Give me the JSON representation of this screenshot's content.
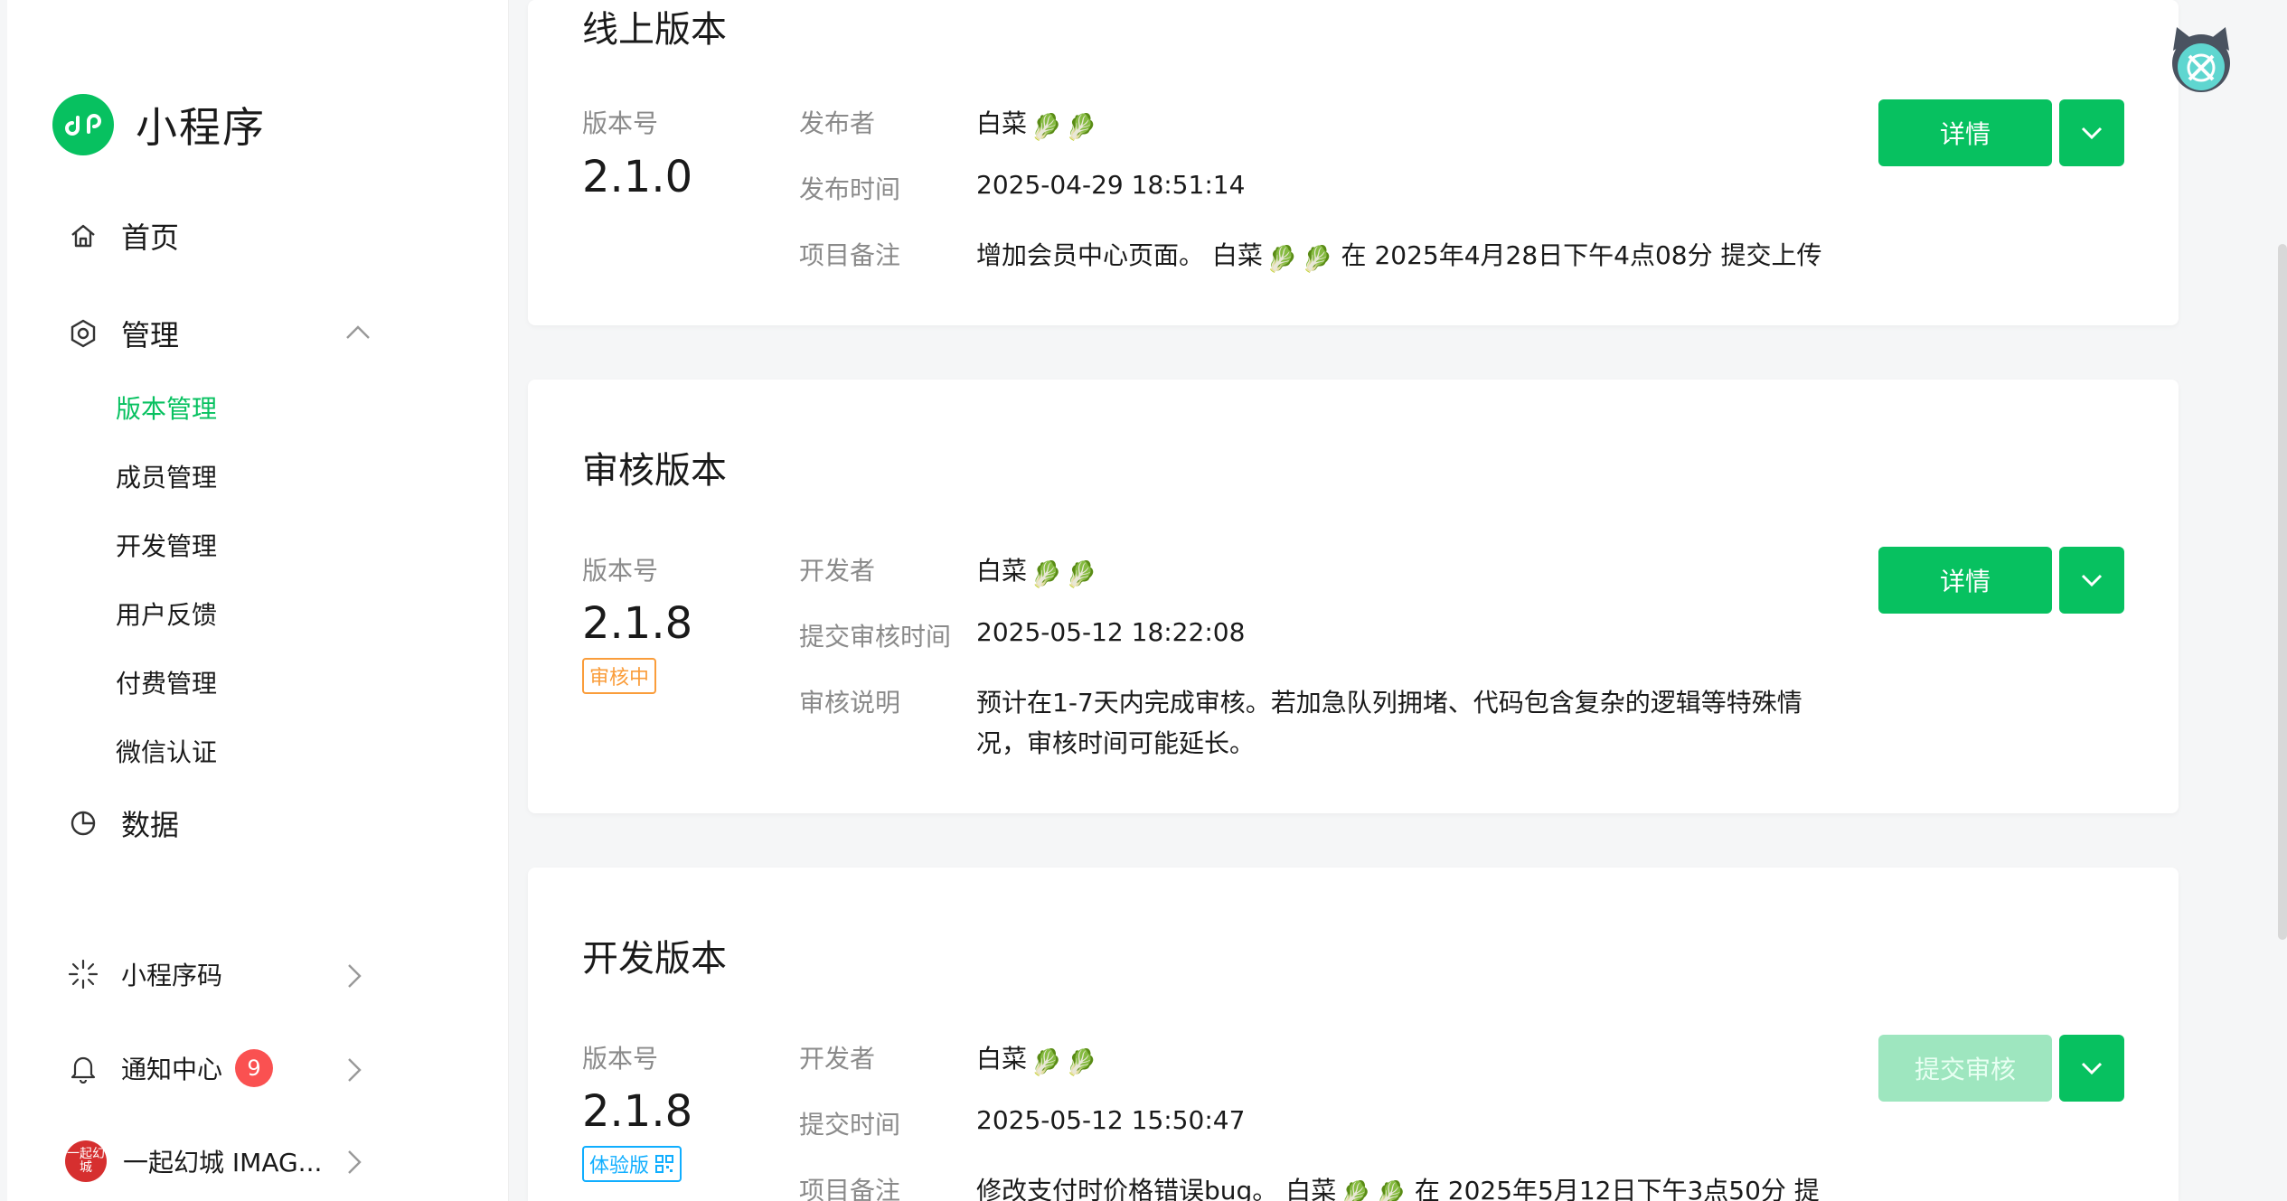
{
  "sidebar": {
    "brand": "小程序",
    "nav": {
      "home": "首页",
      "manage": "管理",
      "data": "数据",
      "qrcode": "小程序码",
      "notify": "通知中心",
      "notify_badge": "9",
      "account": "一起幻城 IMAG...",
      "account_avatar": "一起幻城"
    },
    "sub_items": [
      "版本管理",
      "成员管理",
      "开发管理",
      "用户反馈",
      "付费管理",
      "微信认证"
    ]
  },
  "cards": {
    "online": {
      "title": "线上版本",
      "version_label": "版本号",
      "version": "2.1.0",
      "labels": [
        "发布者",
        "发布时间",
        "项目备注"
      ],
      "publisher": "白菜",
      "time": "2025-04-29 18:51:14",
      "note_pre": "增加会员中心页面。 白菜",
      "note_post": " 在 2025年4月28日下午4点08分 提交上传",
      "btn": "详情"
    },
    "review": {
      "title": "审核版本",
      "version_label": "版本号",
      "version": "2.1.8",
      "tag": "审核中",
      "labels": [
        "开发者",
        "提交审核时间",
        "审核说明"
      ],
      "developer": "白菜",
      "time": "2025-05-12 18:22:08",
      "desc1": "预计在1-7天内完成审核。若加急队列拥堵、代码包含复杂的逻辑等特殊情",
      "desc2": "况，审核时间可能延长。",
      "btn": "详情"
    },
    "dev": {
      "title": "开发版本",
      "version_label": "版本号",
      "version": "2.1.8",
      "tag": "体验版",
      "labels": [
        "开发者",
        "提交时间",
        "项目备注"
      ],
      "developer": "白菜",
      "time": "2025-05-12 15:50:47",
      "note_pre": "修改支付时价格错误bug。 白菜",
      "note_post": " 在 2025年5月12日下午3点50分 提",
      "btn": "提交审核"
    }
  },
  "colors": {
    "accent": "#07c160",
    "orange": "#fa9d3b",
    "blue": "#10aeff",
    "badge": "#fa5151"
  }
}
